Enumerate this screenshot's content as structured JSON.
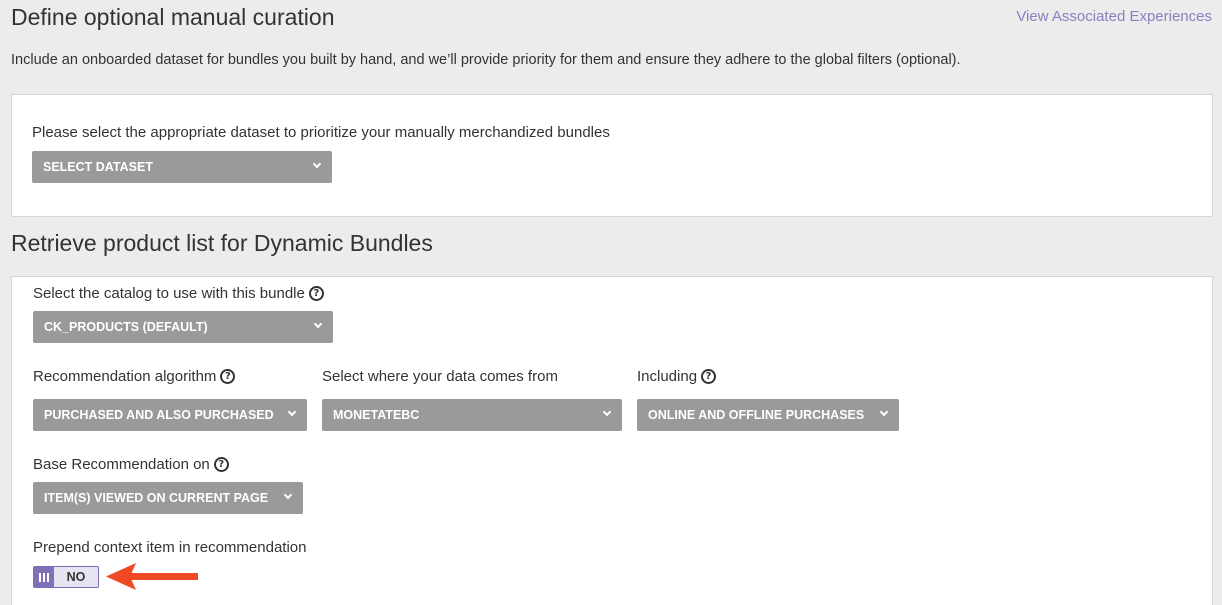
{
  "manual": {
    "title": "Define optional manual curation",
    "link": "View Associated Experiences",
    "description": "Include an onboarded dataset for bundles you built by hand, and we’ll provide priority for them and ensure they adhere to the global filters (optional).",
    "dataset_label": "Please select the appropriate dataset to prioritize your manually merchandized bundles",
    "dataset_value": "SELECT DATASET"
  },
  "retrieve": {
    "title": "Retrieve product list for Dynamic Bundles",
    "catalog_label": "Select the catalog to use with this bundle",
    "catalog_value": "CK_PRODUCTS (DEFAULT)",
    "algorithm_label": "Recommendation algorithm",
    "algorithm_value": "PURCHASED AND ALSO PURCHASED",
    "source_label": "Select where your data comes from",
    "source_value": "MONETATEBC",
    "including_label": "Including",
    "including_value": "ONLINE AND OFFLINE PURCHASES",
    "base_label": "Base Recommendation on",
    "base_value": "ITEM(S) VIEWED ON CURRENT PAGE",
    "prepend_label": "Prepend context item in recommendation",
    "prepend_state": "NO"
  },
  "icons": {
    "help": "question-circle-icon",
    "chevron": "chevron-down-icon",
    "arrow": "arrow-left-icon"
  },
  "colors": {
    "dropdown_bg": "#9a9a9a",
    "toggle_accent": "#8070b8",
    "link": "#8b7fc0",
    "arrow": "#f04a24"
  }
}
